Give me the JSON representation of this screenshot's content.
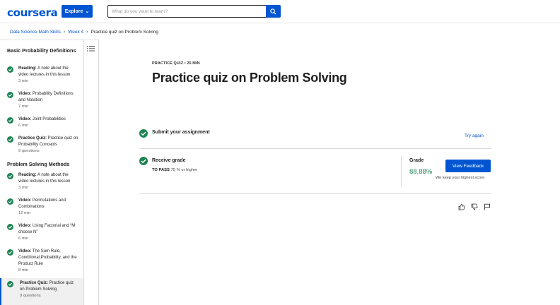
{
  "header": {
    "logo": "coursera",
    "explore_label": "Explore",
    "search_placeholder": "What do you want to learn?",
    "brand_color": "#0056d2"
  },
  "breadcrumb": {
    "items": [
      "Data Science Math Skills",
      "Week 4",
      "Practice quiz on Problem Solving"
    ]
  },
  "sidebar": {
    "sections": [
      {
        "title": "Basic Probability Definitions",
        "items": [
          {
            "kind": "Reading:",
            "title": " A note about the video lectures in this lesson",
            "meta": "3 min"
          },
          {
            "kind": "Video:",
            "title": " Probability Definitions and Notation",
            "meta": "7 min"
          },
          {
            "kind": "Video:",
            "title": " Joint Probabilities",
            "meta": "6 min"
          },
          {
            "kind": "Practice Quiz:",
            "title": " Practice quiz on Probability Concepts",
            "meta": "9 questions"
          }
        ]
      },
      {
        "title": "Problem Solving Methods",
        "items": [
          {
            "kind": "Reading:",
            "title": " A note about the video lectures in this lesson",
            "meta": "3 min"
          },
          {
            "kind": "Video:",
            "title": " Permutations and Combinations",
            "meta": "12 min"
          },
          {
            "kind": "Video:",
            "title": " Using Factorial and “M choose N”",
            "meta": "6 min"
          },
          {
            "kind": "Video:",
            "title": " The Sum Rule, Conditional Probability, and the Product Rule",
            "meta": "8 min"
          },
          {
            "kind": "Practice Quiz:",
            "title": " Practice quiz on Problem Solving",
            "meta": "9 questions"
          }
        ]
      }
    ],
    "active_item": "Practice quiz on Problem Solving"
  },
  "main": {
    "label": "PRACTICE QUIZ • 25 MIN",
    "title": "Practice quiz on Problem Solving",
    "submit": {
      "label": "Submit your assignment",
      "action": "Try again"
    },
    "receive": {
      "label": "Receive grade",
      "to_pass_label": "TO PASS",
      "to_pass_value": " 75 % or higher"
    },
    "grade": {
      "label": "Grade",
      "value": "88.88%",
      "button": "View Feedback",
      "note": "We keep your highest score",
      "value_color": "#1f8354"
    },
    "feedback_icons": [
      "thumbs-up-icon",
      "thumbs-down-icon",
      "flag-icon"
    ]
  },
  "colors": {
    "check_green": "#1f8354",
    "link_blue": "#0056d2"
  }
}
